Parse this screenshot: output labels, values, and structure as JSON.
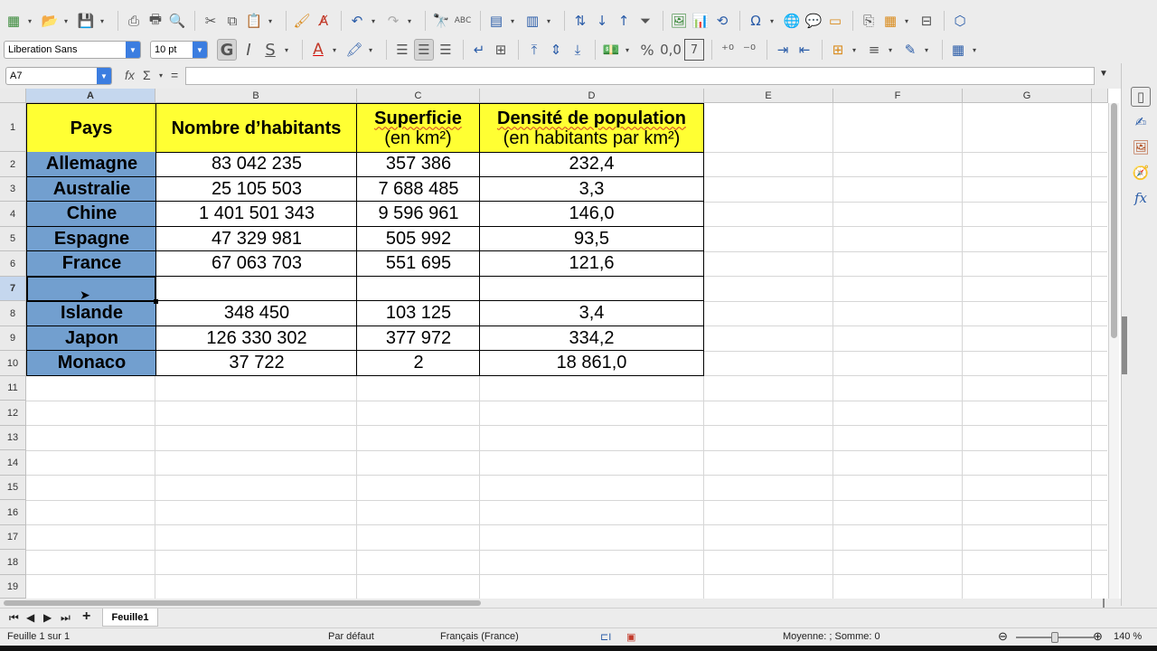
{
  "toolbar": {
    "font_name": "Liberation Sans",
    "font_size": "10 pt",
    "bold_label": "G",
    "italic_label": "I",
    "shadow_label": "S",
    "percent_label": "%",
    "decimal_label": "0,0"
  },
  "formula_bar": {
    "name_box": "A7",
    "fx": "fx",
    "sigma": "Σ",
    "equals": "=",
    "content": ""
  },
  "columns": [
    "A",
    "B",
    "C",
    "D",
    "E",
    "F",
    "G"
  ],
  "rows": [
    "1",
    "2",
    "3",
    "4",
    "5",
    "6",
    "7",
    "8",
    "9",
    "10",
    "11",
    "12",
    "13",
    "14",
    "15",
    "16",
    "17",
    "18",
    "19"
  ],
  "table": {
    "headers": {
      "pays": "Pays",
      "habitants": "Nombre d’habitants",
      "superficie": "Superficie",
      "superficie_unit": "(en km²)",
      "densite": "Densité de population",
      "densite_unit": "(en habitants par km²)"
    },
    "rows": [
      {
        "pays": "Allemagne",
        "habitants": "83 042 235",
        "superficie": "357 386",
        "densite": "232,4"
      },
      {
        "pays": "Australie",
        "habitants": "25 105 503",
        "superficie": "7 688 485",
        "densite": "3,3"
      },
      {
        "pays": "Chine",
        "habitants": "1 401 501 343",
        "superficie": "9 596 961",
        "densite": "146,0"
      },
      {
        "pays": "Espagne",
        "habitants": "47 329 981",
        "superficie": "505 992",
        "densite": "93,5"
      },
      {
        "pays": "France",
        "habitants": "67 063 703",
        "superficie": "551 695",
        "densite": "121,6"
      },
      {
        "pays": "",
        "habitants": "",
        "superficie": "",
        "densite": ""
      },
      {
        "pays": "Islande",
        "habitants": "348 450",
        "superficie": "103 125",
        "densite": "3,4"
      },
      {
        "pays": "Japon",
        "habitants": "126 330 302",
        "superficie": "377 972",
        "densite": "334,2"
      },
      {
        "pays": "Monaco",
        "habitants": "37 722",
        "superficie": "2",
        "densite": "18 861,0"
      }
    ]
  },
  "sheet_tabs": {
    "active": "Feuille1"
  },
  "status_bar": {
    "sheet_info": "Feuille 1 sur 1",
    "page_style": "Par défaut",
    "language": "Français (France)",
    "summary": "Moyenne: ; Somme: 0",
    "zoom": "140 %"
  },
  "colors": {
    "header_fill": "#ffff33",
    "country_fill": "#729fcf",
    "selection_header": "#c5d7ee"
  }
}
